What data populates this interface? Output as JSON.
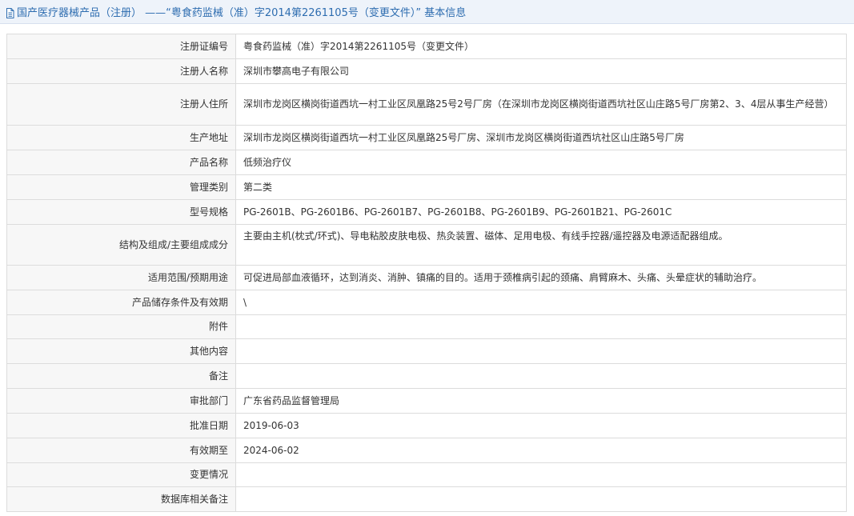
{
  "header": {
    "title": "国产医疗器械产品（注册） ——“粤食药监械（准）字2014第2261105号（变更文件）” 基本信息",
    "icon": "document-icon"
  },
  "colors": {
    "title_text": "#2e6db0",
    "header_bg": "#eef3fa",
    "label_bg": "#f7f7f7",
    "border": "#dcdcdc"
  },
  "rows": [
    {
      "label": "注册证编号",
      "value": "粤食药监械（准）字2014第2261105号（变更文件）"
    },
    {
      "label": "注册人名称",
      "value": "深圳市攀高电子有限公司"
    },
    {
      "label": "注册人住所",
      "value": "深圳市龙岗区横岗街道西坑一村工业区凤凰路25号2号厂房（在深圳市龙岗区横岗街道西坑社区山庄路5号厂房第2、3、4层从事生产经营）"
    },
    {
      "label": "生产地址",
      "value": "深圳市龙岗区横岗街道西坑一村工业区凤凰路25号厂房、深圳市龙岗区横岗街道西坑社区山庄路5号厂房"
    },
    {
      "label": "产品名称",
      "value": "低频治疗仪"
    },
    {
      "label": "管理类别",
      "value": "第二类"
    },
    {
      "label": "型号规格",
      "value": "PG-2601B、PG-2601B6、PG-2601B7、PG-2601B8、PG-2601B9、PG-2601B21、PG-2601C"
    },
    {
      "label": "结构及组成/主要组成成分",
      "value": "主要由主机(枕式/环式)、导电粘胶皮肤电极、热灸装置、磁体、足用电极、有线手控器/遥控器及电源适配器组成。"
    },
    {
      "label": "适用范围/预期用途",
      "value": "可促进局部血液循环，达到消炎、消肿、镇痛的目的。适用于颈椎病引起的颈痛、肩臂麻木、头痛、头晕症状的辅助治疗。"
    },
    {
      "label": "产品储存条件及有效期",
      "value": "\\"
    },
    {
      "label": "附件",
      "value": ""
    },
    {
      "label": "其他内容",
      "value": ""
    },
    {
      "label": "备注",
      "value": ""
    },
    {
      "label": "审批部门",
      "value": "广东省药品监督管理局"
    },
    {
      "label": "批准日期",
      "value": "2019-06-03"
    },
    {
      "label": "有效期至",
      "value": "2024-06-02"
    },
    {
      "label": "变更情况",
      "value": ""
    },
    {
      "label": "数据库相关备注",
      "value": ""
    }
  ]
}
